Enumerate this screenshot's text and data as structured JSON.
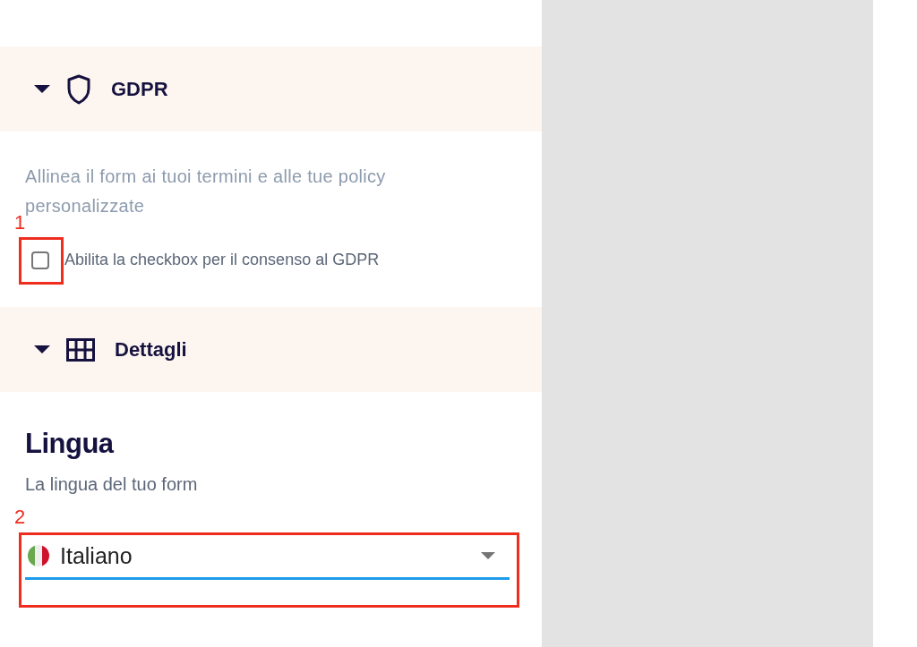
{
  "sections": [
    {
      "kind": "gdpr",
      "title": "GDPR",
      "expanded": true,
      "description": "Allinea il form ai tuoi termini e alle tue policy personalizzate",
      "checkbox": {
        "label": "Abilita la checkbox per il consenso al GDPR",
        "checked": false
      }
    },
    {
      "kind": "details",
      "title": "Dettagli",
      "expanded": true,
      "heading": "Lingua",
      "subtitle": "La lingua del tuo form",
      "select": {
        "value": "Italiano"
      }
    }
  ],
  "callouts": [
    {
      "number": "1"
    },
    {
      "number": "2"
    }
  ]
}
